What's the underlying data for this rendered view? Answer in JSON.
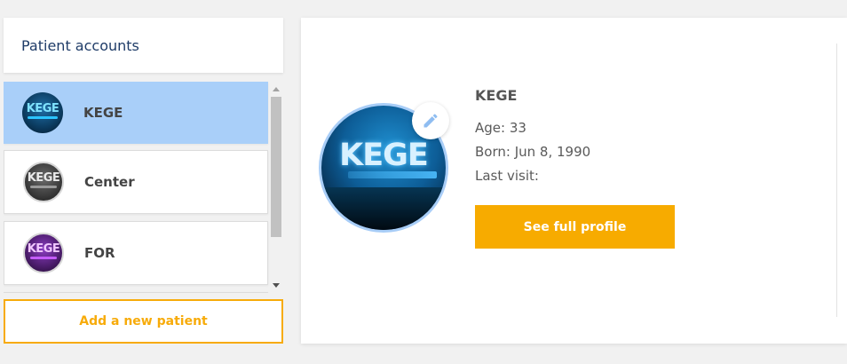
{
  "sidebar": {
    "title": "Patient accounts",
    "add_button_label": "Add a new patient",
    "patients": [
      {
        "name": "KEGE",
        "logo_text": "KEGE",
        "selected": true,
        "avatar_bg": "#0b3a5e",
        "logo_color": "#7fe2ff",
        "accent": "#2bc4ff"
      },
      {
        "name": "Center",
        "logo_text": "KEGE",
        "selected": false,
        "avatar_bg": "#3b3b3b",
        "logo_color": "#e9e9e9",
        "accent": "#9a9a9a"
      },
      {
        "name": "FOR",
        "logo_text": "KEGE",
        "selected": false,
        "avatar_bg": "#4b1c6b",
        "logo_color": "#f1c8ff",
        "accent": "#c55cff"
      }
    ]
  },
  "profile": {
    "name": "KEGE",
    "age_line": "Age: 33",
    "born_line": "Born: Jun 8, 1990",
    "last_visit_line": "Last visit:",
    "photo_logo_text": "KEGE",
    "see_profile_label": "See full profile",
    "edit_icon": "pencil-icon"
  },
  "colors": {
    "accent": "#f7ab00",
    "selected_row": "#a9cff9",
    "title": "#1f3c68",
    "edit_icon": "#8fbdf1"
  }
}
